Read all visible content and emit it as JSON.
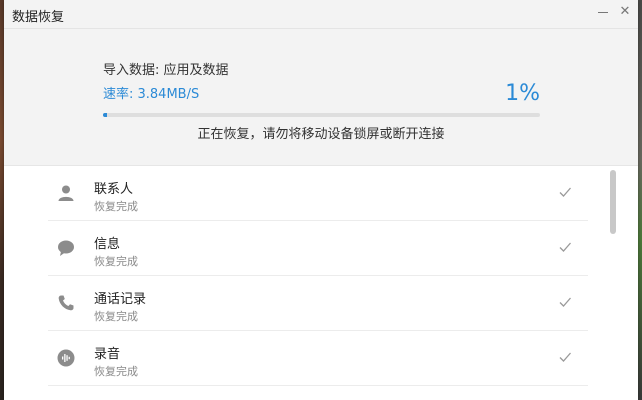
{
  "window": {
    "title": "数据恢复",
    "min_glyph": "—",
    "close_glyph": "✕"
  },
  "progress": {
    "import_label": "导入数据: 应用及数据",
    "rate": "速率: 3.84MB/S",
    "percent_text": "1%",
    "percent_value": 0.01,
    "status": "正在恢复，请勿将移动设备锁屏或断开连接"
  },
  "items": [
    {
      "name": "联系人",
      "status": "恢复完成",
      "icon": "contact-icon"
    },
    {
      "name": "信息",
      "status": "恢复完成",
      "icon": "message-icon"
    },
    {
      "name": "通话记录",
      "status": "恢复完成",
      "icon": "phone-icon"
    },
    {
      "name": "录音",
      "status": "恢复完成",
      "icon": "recording-icon"
    }
  ],
  "colors": {
    "accent": "#2b8ad6",
    "icon": "#8c8c8c",
    "check": "#9a9a9a"
  }
}
